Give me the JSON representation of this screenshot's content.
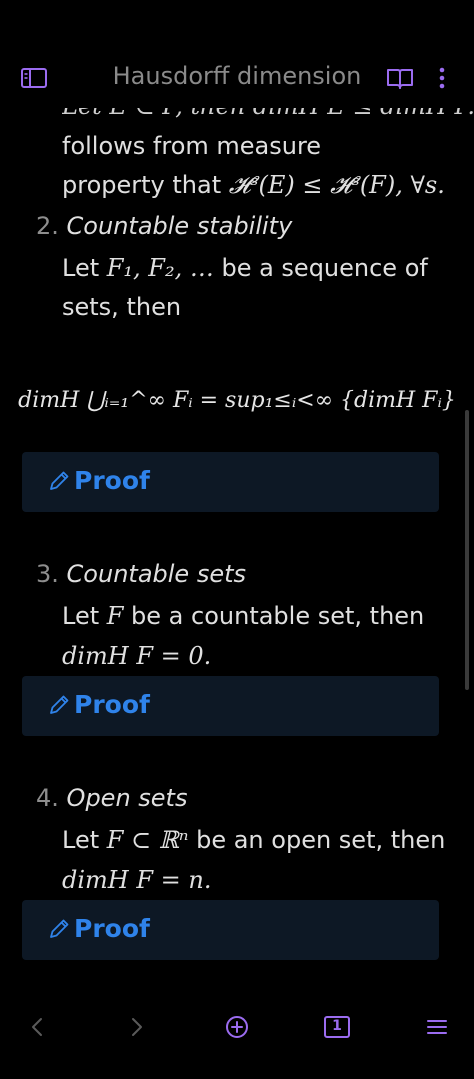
{
  "header": {
    "title": "Hausdorff dimension",
    "icons": [
      "sidebar-toggle-icon",
      "reading-mode-book-icon",
      "more-options-icon"
    ],
    "accent_color": "#9b6cf0"
  },
  "content": {
    "cut_line": "Let E ⊂ F, then dimH E ≤ dimH F. It",
    "line1": "follows from measure",
    "line2_prefix": "property that ",
    "line2_math": "𝓗ˢ(E) ≤ 𝓗ˢ(F), ∀s.",
    "items": [
      {
        "number": "2.",
        "title": "Countable stability",
        "line1_prefix": "Let ",
        "line1_math": "F₁, F₂, …",
        "line1_suffix": " be a sequence of",
        "line2": "sets, then",
        "formula": "dimH ⋃ᵢ₌₁^∞ Fᵢ = sup₁≤ᵢ<∞ {dimH Fᵢ}",
        "proof_label": "Proof"
      },
      {
        "number": "3.",
        "title": "Countable sets",
        "line1_prefix": "Let ",
        "line1_math": "F",
        "line1_suffix": " be a countable set, then",
        "line2_math": "dimH F = 0.",
        "proof_label": "Proof"
      },
      {
        "number": "4.",
        "title": "Open sets",
        "line1_prefix": "Let ",
        "line1_math": "F ⊂ ℝⁿ",
        "line1_suffix": " be an open set, then",
        "line2_math": "dimH F = n.",
        "proof_label": "Proof"
      }
    ],
    "proof_color": "#2f83ea"
  },
  "bottom_nav": {
    "icons": [
      "back-icon",
      "forward-icon",
      "new-note-icon",
      "tabs-count-icon",
      "menu-icon"
    ],
    "tab_count": "1"
  }
}
